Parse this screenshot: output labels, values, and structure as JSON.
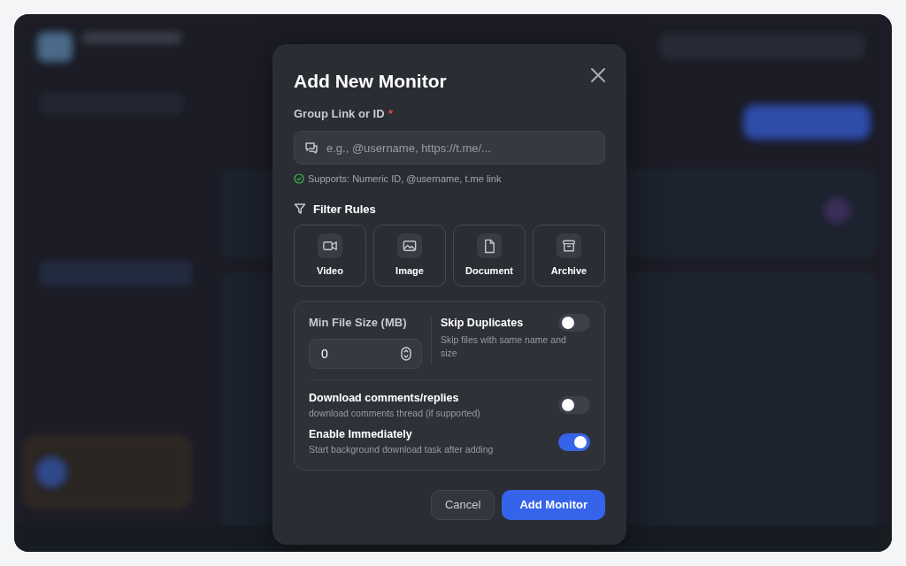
{
  "modal": {
    "title": "Add New Monitor",
    "group_field": {
      "label": "Group Link or ID",
      "required_mark": "*",
      "placeholder": "e.g., @username, https://t.me/...",
      "hint": "Supports: Numeric ID, @username, t.me link"
    },
    "filter_rules": {
      "heading": "Filter Rules",
      "types": [
        {
          "kind": "video",
          "label": "Video"
        },
        {
          "kind": "image",
          "label": "Image"
        },
        {
          "kind": "document",
          "label": "Document"
        },
        {
          "kind": "archive",
          "label": "Archive"
        }
      ]
    },
    "min_file_size": {
      "label": "Min File Size (MB)",
      "value": "0"
    },
    "skip_duplicates": {
      "label": "Skip Duplicates",
      "description": "Skip files with same name and size",
      "on": false
    },
    "options": [
      {
        "label": "Download comments/replies",
        "description": "download comments thread (if supported)",
        "on": false
      },
      {
        "label": "Enable Immediately",
        "description": "Start background download task after adding",
        "on": true
      }
    ],
    "buttons": {
      "cancel": "Cancel",
      "submit": "Add Monitor"
    }
  }
}
